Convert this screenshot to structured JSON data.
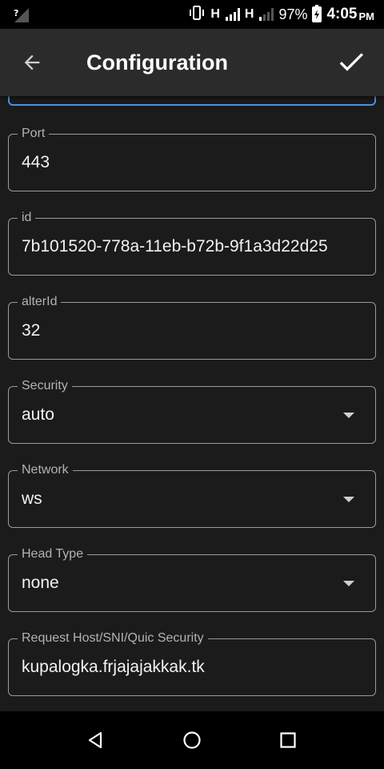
{
  "status_bar": {
    "network_1": "H",
    "network_2": "H",
    "battery_percent": "97%",
    "time": "4:05",
    "ampm": "PM"
  },
  "app_bar": {
    "title": "Configuration"
  },
  "form": {
    "port": {
      "label": "Port",
      "value": "443"
    },
    "id": {
      "label": "id",
      "value": "7b101520-778a-11eb-b72b-9f1a3d22d25"
    },
    "alter_id": {
      "label": "alterId",
      "value": "32"
    },
    "security": {
      "label": "Security",
      "value": "auto"
    },
    "network": {
      "label": "Network",
      "value": "ws"
    },
    "head_type": {
      "label": "Head Type",
      "value": "none"
    },
    "request_host": {
      "label": "Request Host/SNI/Quic Security",
      "value": "kupalogka.frjajajakkak.tk"
    }
  },
  "colors": {
    "accent_focus": "#4d90e0",
    "background": "#1b1b1b",
    "app_bar": "#2b2b2b"
  }
}
